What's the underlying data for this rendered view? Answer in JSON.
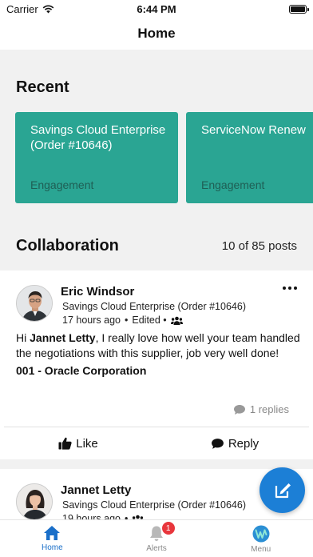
{
  "status_bar": {
    "carrier": "Carrier",
    "time": "6:44 PM"
  },
  "nav": {
    "title": "Home"
  },
  "recent": {
    "title": "Recent",
    "cards": [
      {
        "title_line1": "Savings Cloud Enterprise",
        "title_line2": "(Order #10646)",
        "subtitle": "Engagement"
      },
      {
        "title_line1": "ServiceNow Renew",
        "title_line2": "",
        "subtitle": "Engagement"
      }
    ]
  },
  "collaboration": {
    "title": "Collaboration",
    "count": "10 of 85 posts",
    "posts": [
      {
        "author": "Eric Windsor",
        "reference": "Savings Cloud Enterprise (Order #10646)",
        "time": "17 hours ago",
        "separator": "•",
        "edited": "Edited •",
        "body_prefix": "Hi ",
        "body_mention": "Jannet Letty",
        "body_text": ", I really love how well your team handled the negotiations with this supplier, job very well done!",
        "supplier": "001 - Oracle Corporation",
        "replies": "1 replies",
        "like_label": "Like",
        "reply_label": "Reply"
      },
      {
        "author": "Jannet Letty",
        "reference": "Savings Cloud Enterprise (Order #10646)",
        "time": "19 hours ago",
        "separator": "•"
      }
    ]
  },
  "tabs": [
    {
      "label": "Home",
      "icon": "home-icon",
      "active": true
    },
    {
      "label": "Alerts",
      "icon": "bell-icon",
      "badge": "1"
    },
    {
      "label": "Menu",
      "icon": "menu-logo-icon"
    }
  ],
  "colors": {
    "card": "#2aa593",
    "accent": "#1c7fd6",
    "badge": "#e8363c"
  }
}
